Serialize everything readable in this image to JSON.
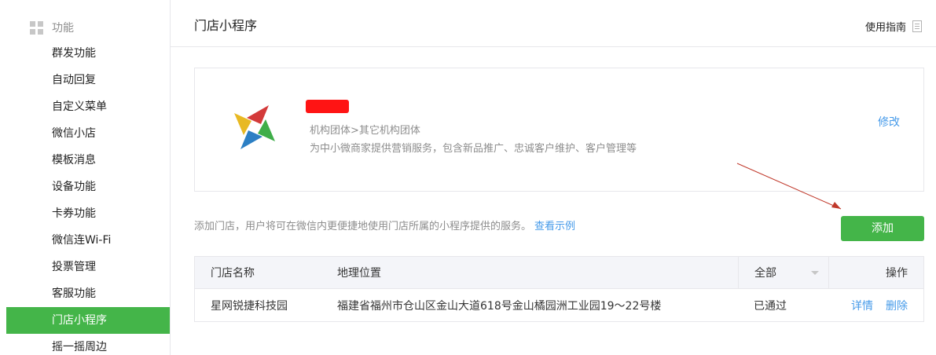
{
  "sidebar": {
    "section_label": "功能",
    "section_icon": "grid-icon",
    "items": [
      {
        "label": "群发功能"
      },
      {
        "label": "自动回复"
      },
      {
        "label": "自定义菜单"
      },
      {
        "label": "微信小店"
      },
      {
        "label": "模板消息"
      },
      {
        "label": "设备功能"
      },
      {
        "label": "卡券功能"
      },
      {
        "label": "微信连Wi-Fi"
      },
      {
        "label": "投票管理"
      },
      {
        "label": "客服功能"
      },
      {
        "label": "门店小程序",
        "active": true
      },
      {
        "label": "摇一摇周边"
      }
    ]
  },
  "header": {
    "title": "门店小程序",
    "guide_label": "使用指南",
    "guide_icon": "document-icon"
  },
  "profile": {
    "category": "机构团体>其它机构团体",
    "description": "为中小微商家提供营销服务，包含新品推广、忠诚客户维护、客户管理等",
    "edit_label": "修改"
  },
  "store_hint": {
    "text": "添加门店，用户将可在微信内更便捷地使用门店所属的小程序提供的服务。",
    "example_link": "查看示例"
  },
  "add_button": "添加",
  "table": {
    "columns": {
      "name": "门店名称",
      "location": "地理位置",
      "status_filter": "全部",
      "actions": "操作"
    },
    "rows": [
      {
        "name": "星网锐捷科技园",
        "location": "福建省福州市仓山区金山大道618号金山橘园洲工业园19～22号楼",
        "status": "已通过",
        "detail": "详情",
        "delete": "删除"
      }
    ]
  },
  "colors": {
    "accent_green": "#44b549",
    "link_blue": "#459ae9",
    "redaction_red": "#ff1414",
    "annotation_arrow": "#c0392b"
  }
}
